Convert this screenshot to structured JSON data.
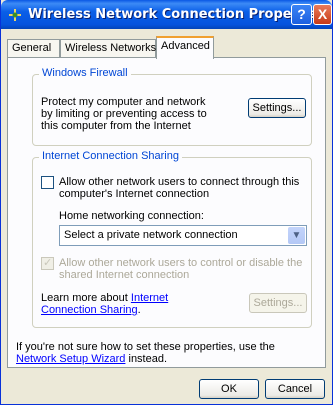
{
  "window": {
    "title": "Wireless Network Connection Properties",
    "help_label": "?",
    "close_label": "X"
  },
  "tabs": [
    {
      "label": "General"
    },
    {
      "label": "Wireless Networks"
    },
    {
      "label": "Advanced"
    }
  ],
  "firewall": {
    "title": "Windows Firewall",
    "description": "Protect my computer and network by limiting or preventing access to this computer from the Internet",
    "settings_label": "Settings..."
  },
  "ics": {
    "title": "Internet Connection Sharing",
    "allow_connect_label": "Allow other network users to connect through this computer's Internet connection",
    "allow_connect_checked": false,
    "home_connection_label": "Home networking connection:",
    "home_connection_value": "Select a private network connection",
    "allow_control_label": "Allow other network users to control or disable the shared Internet connection",
    "allow_control_checked": true,
    "learn_more_prefix": "Learn more about ",
    "learn_more_link": "Internet Connection Sharing",
    "learn_more_suffix": ".",
    "settings_label": "Settings..."
  },
  "footer": {
    "text_prefix": "If you're not sure how to set these properties, use the ",
    "wizard_link": "Network Setup Wizard",
    "text_suffix": " instead.",
    "ok_label": "OK",
    "cancel_label": "Cancel"
  },
  "colors": {
    "titlebar": "#0a58e4",
    "group_title": "#0046d5",
    "link": "#0000ff",
    "active_tab_accent": "#f0a030"
  }
}
